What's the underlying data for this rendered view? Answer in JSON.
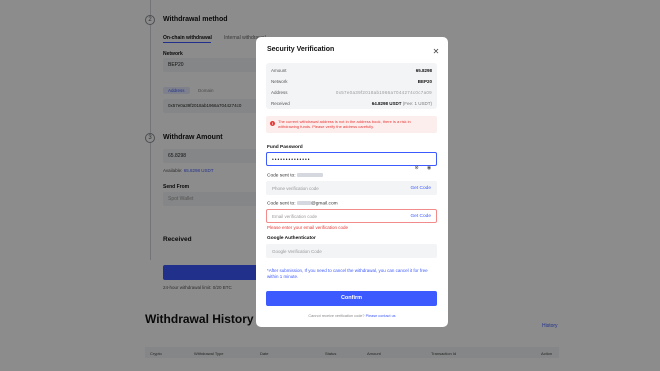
{
  "background": {
    "step2_title": "Withdrawal method",
    "step2_number": "2",
    "tabs": [
      "On-chain withdrawal",
      "Internal withdrawal"
    ],
    "network_label": "Network",
    "network_value": "BEP20",
    "address_pills": [
      "Address",
      "Domain"
    ],
    "address_value": "0x57e0a39f2018ab1966a7044274c0",
    "step3_number": "3",
    "step3_title": "Withdraw Amount",
    "amount_value": "65.8298",
    "available_prefix": "Available:",
    "available_value": "65.8298 USDT",
    "send_from_label": "Send From",
    "send_from_value": "Spot Wallet",
    "received_label": "Received",
    "limit_text": "24-hour withdrawal limit: 0/20 BTC",
    "history_title": "Withdrawal History",
    "history_link": "History",
    "history_columns": [
      "Crypto",
      "Withdrawal Type",
      "Date",
      "Status",
      "Amount",
      "Transaction Id",
      "Action"
    ]
  },
  "modal": {
    "title": "Security Verification",
    "close_icon": "close-icon",
    "summary": {
      "amount_label": "Amount",
      "amount_value": "65.8298",
      "network_label": "Network",
      "network_value": "BEP20",
      "address_label": "Address",
      "address_value": "0x57e0a39f2018ab1966a7044274c0c7a09",
      "received_label": "Received",
      "received_value": "64.8298 USDT",
      "received_fee": "(Fee: 1 USDT)"
    },
    "warning": "The current withdrawal address is not in the address book, there is a risk in withdrawing funds. Please verify the address carefully.",
    "fund_password_label": "Fund Password",
    "fund_password_value": "••••••••••••••",
    "phone_label": "Code sent to:",
    "phone_placeholder": "Phone verification code",
    "email_label_prefix": "Code sent to:",
    "email_label_suffix": "@gmail.com",
    "email_placeholder": "Email verification code",
    "email_error": "Please enter your email verification code",
    "get_code": "Get Code",
    "ga_label": "Google Authenticator",
    "ga_placeholder": "Google Verification Code",
    "note": "*After submission, If you need to cancel the withdrawal, you can cancel it for free within 1 minute.",
    "confirm": "Confirm",
    "footer_text": "Cannot receive verification code?",
    "footer_link": "Please contact us"
  },
  "colors": {
    "accent": "#3d5afe",
    "error": "#e53935",
    "overlay": "rgba(0,0,0,0.45)"
  }
}
